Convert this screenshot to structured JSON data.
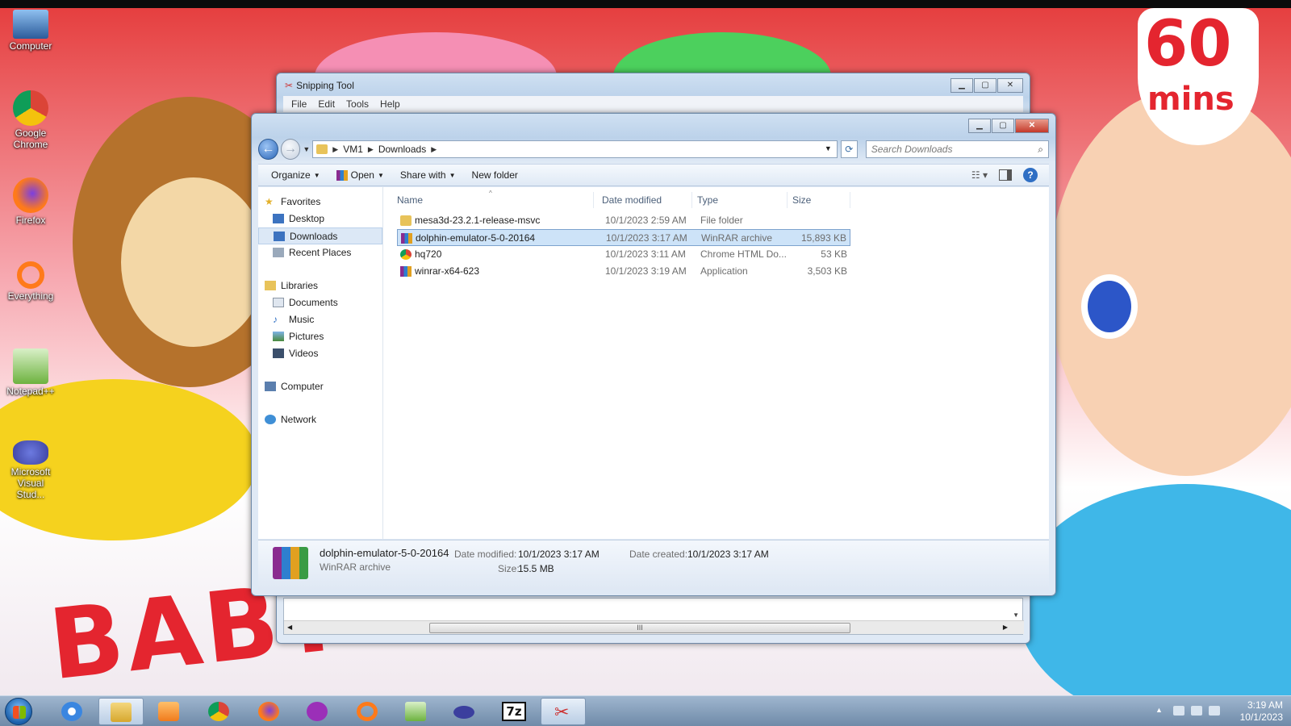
{
  "desktop": {
    "icons": [
      {
        "label": "Computer"
      },
      {
        "label": "Google Chrome"
      },
      {
        "label": "Firefox"
      },
      {
        "label": "Everything"
      },
      {
        "label": "Notepad++"
      },
      {
        "label": "Microsoft Visual Stud..."
      }
    ],
    "wallpaper": {
      "badge_number": "60",
      "badge_unit": "mins",
      "brand": "BABY YOYO"
    }
  },
  "snipping_tool": {
    "title": "Snipping Tool",
    "menu": [
      "File",
      "Edit",
      "Tools",
      "Help"
    ],
    "scroll_marker": "III"
  },
  "explorer": {
    "breadcrumb": [
      "VM1",
      "Downloads"
    ],
    "search_placeholder": "Search Downloads",
    "commands": {
      "organize": "Organize",
      "open": "Open",
      "share_with": "Share with",
      "new_folder": "New folder"
    },
    "nav": {
      "favorites": "Favorites",
      "desktop": "Desktop",
      "downloads": "Downloads",
      "recent_places": "Recent Places",
      "libraries": "Libraries",
      "documents": "Documents",
      "music": "Music",
      "pictures": "Pictures",
      "videos": "Videos",
      "computer": "Computer",
      "network": "Network"
    },
    "columns": {
      "name": "Name",
      "date": "Date modified",
      "type": "Type",
      "size": "Size"
    },
    "files": [
      {
        "name": "mesa3d-23.2.1-release-msvc",
        "date": "10/1/2023 2:59 AM",
        "type": "File folder",
        "size": ""
      },
      {
        "name": "dolphin-emulator-5-0-20164",
        "date": "10/1/2023 3:17 AM",
        "type": "WinRAR archive",
        "size": "15,893 KB"
      },
      {
        "name": "hq720",
        "date": "10/1/2023 3:11 AM",
        "type": "Chrome HTML Do...",
        "size": "53 KB"
      },
      {
        "name": "winrar-x64-623",
        "date": "10/1/2023 3:19 AM",
        "type": "Application",
        "size": "3,503 KB"
      }
    ],
    "details": {
      "name": "dolphin-emulator-5-0-20164",
      "type": "WinRAR archive",
      "date_modified_label": "Date modified:",
      "date_modified": "10/1/2023 3:17 AM",
      "date_created_label": "Date created:",
      "date_created": "10/1/2023 3:17 AM",
      "size_label": "Size:",
      "size": "15.5 MB"
    }
  },
  "taskbar": {
    "apps": [
      "internet-explorer",
      "windows-explorer",
      "media-player",
      "chrome",
      "firefox",
      "mask-app",
      "everything-search",
      "notepad-plus-plus",
      "visual-studio",
      "7zip",
      "snipping-tool"
    ],
    "seven_zip_label": "7z",
    "clock_time": "3:19 AM",
    "clock_date": "10/1/2023"
  },
  "colors": {
    "selection": "#cde3f8",
    "accent": "#2f6fc4",
    "close_button": "#c4392a"
  }
}
